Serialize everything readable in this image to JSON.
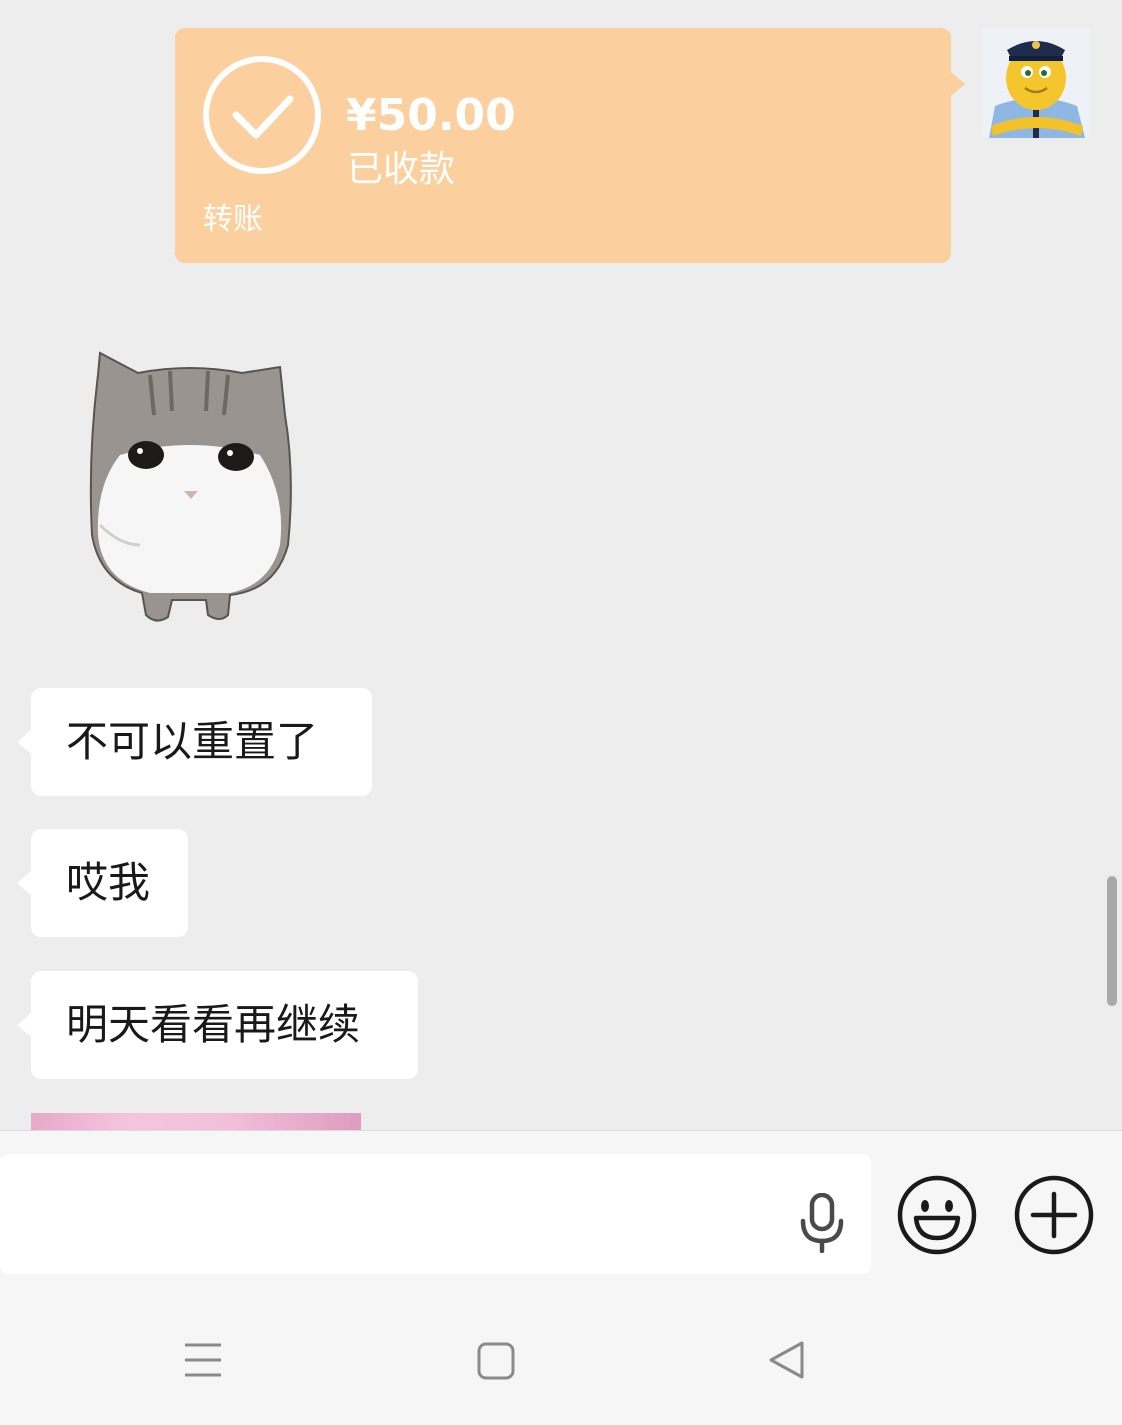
{
  "messages": {
    "transfer": {
      "amount": "¥50.00",
      "status": "已收款",
      "type": "转账",
      "color": "#fbcf9e"
    },
    "incoming": [
      {
        "text": "不可以重置了"
      },
      {
        "text": "哎我"
      },
      {
        "text": "明天看看再继续"
      }
    ]
  },
  "input_bar": {
    "value": "",
    "icons": [
      "mic-icon",
      "emoji-icon",
      "plus-icon"
    ]
  },
  "nav_bar": {
    "icons": [
      "menu-icon",
      "home-square-icon",
      "back-triangle-icon"
    ]
  },
  "colors": {
    "background": "#ededed",
    "bubble": "#ffffff",
    "transfer": "#fbcf9e"
  }
}
